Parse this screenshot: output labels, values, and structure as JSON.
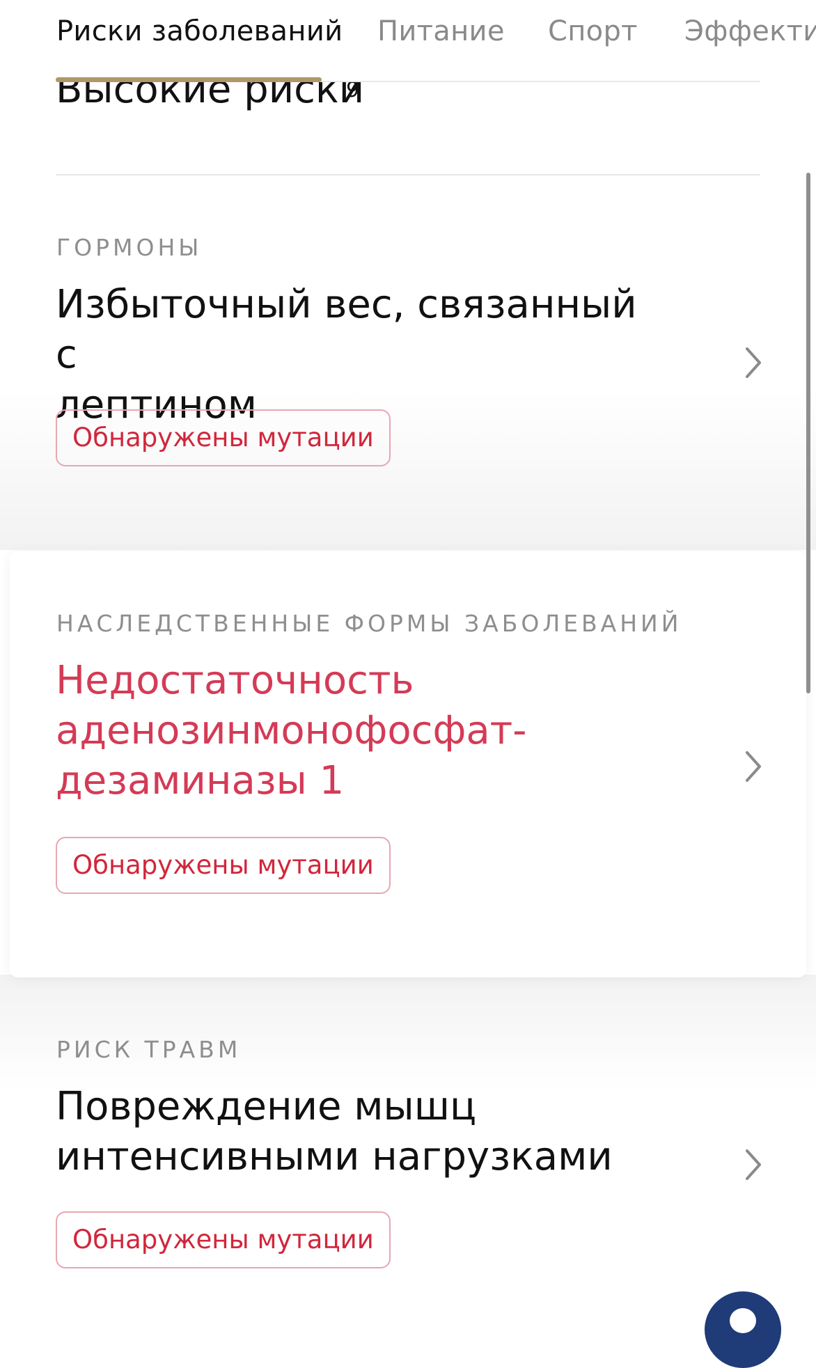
{
  "tabs": [
    {
      "label": "Риски заболеваний",
      "active": true
    },
    {
      "label": "Питание",
      "active": false
    },
    {
      "label": "Спорт",
      "active": false
    },
    {
      "label": "Эффективность",
      "active": false
    }
  ],
  "section": {
    "heading": "Высокие риски",
    "count": "9"
  },
  "cards": [
    {
      "category": "ГОРМОНЫ",
      "title_lines": [
        "Избыточный вес, связанный с",
        "лептином"
      ],
      "badge": "Обнаружены мутации",
      "chevron_icon": "chevron-right-icon"
    },
    {
      "category": "НАСЛЕДСТВЕННЫЕ ФОРМЫ ЗАБОЛЕВАНИЙ",
      "title_lines": [
        "Недостаточность",
        "аденозинмонофосфат-",
        "дезаминазы 1"
      ],
      "badge": "Обнаружены мутации",
      "chevron_icon": "chevron-right-icon"
    },
    {
      "category": "РИСК ТРАВМ",
      "title_lines": [
        "Повреждение мышц",
        "интенсивными нагрузками"
      ],
      "badge": "Обнаружены мутации",
      "chevron_icon": "chevron-right-icon"
    }
  ],
  "colors": {
    "accent_gold": "#b0976a",
    "alert_red": "#d2263b",
    "title_red": "#d43b56",
    "badge_border": "#e8a7b2",
    "fab_navy": "#1f3b78"
  }
}
